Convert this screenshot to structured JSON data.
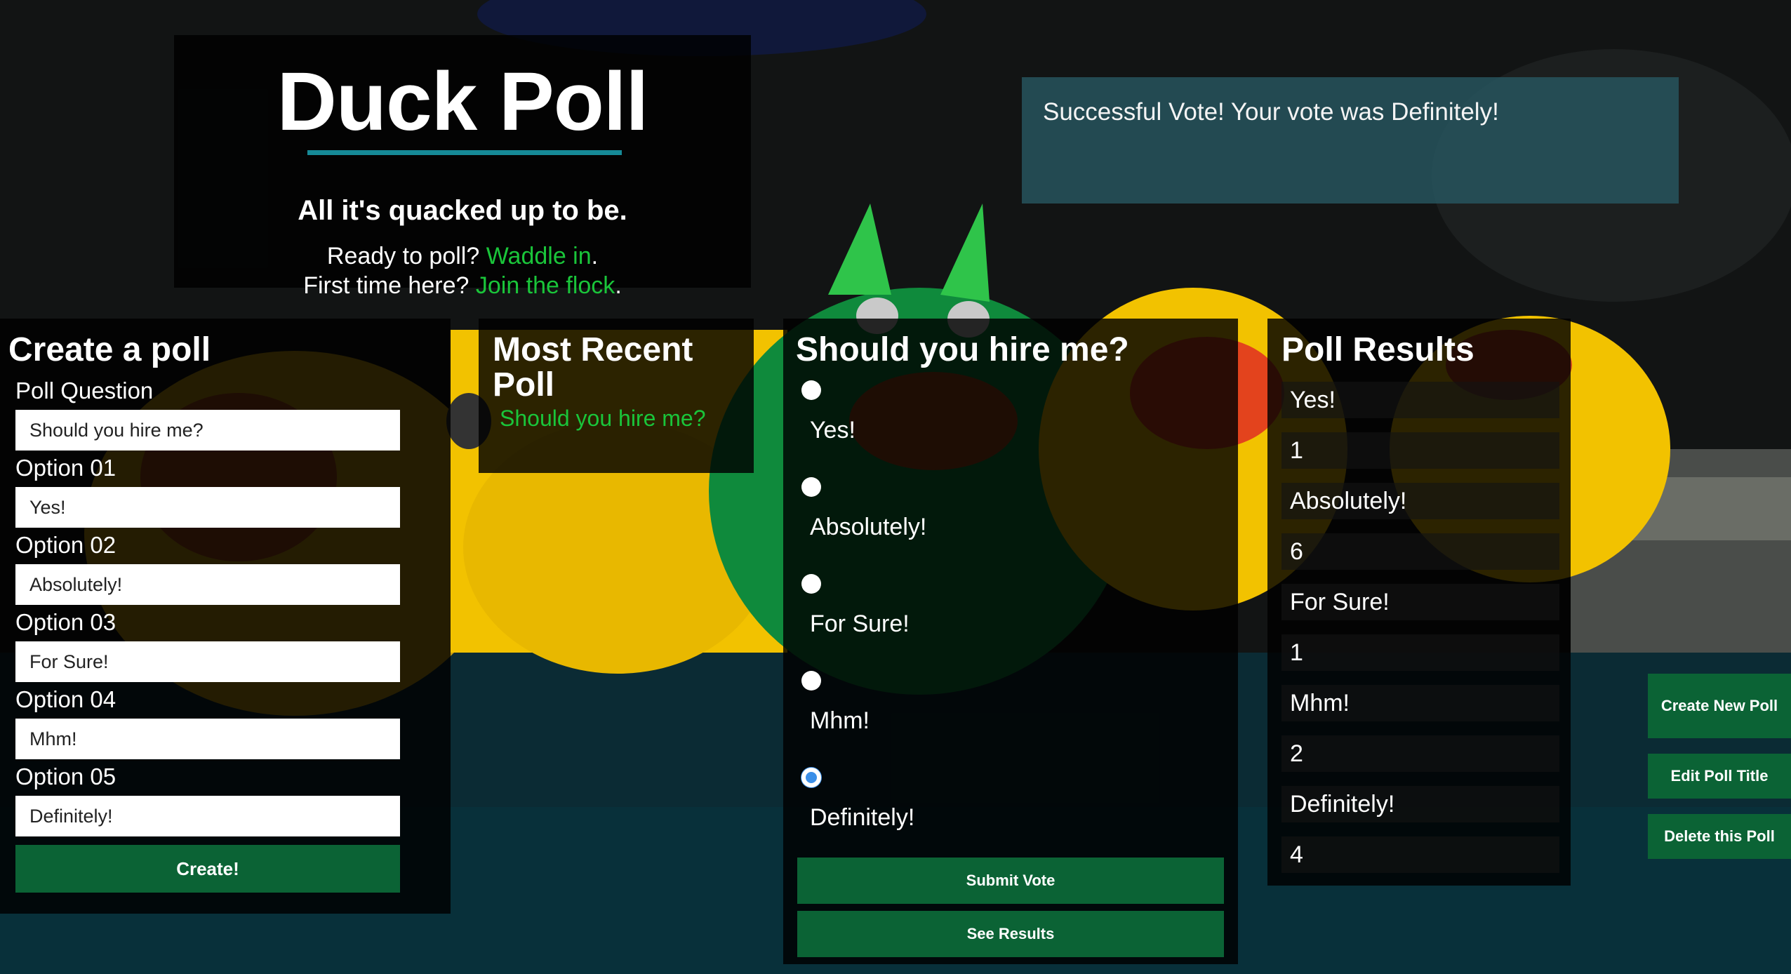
{
  "header": {
    "title": "Duck Poll",
    "tagline": "All it's quacked up to be.",
    "ready_text": "Ready to poll?",
    "ready_link": "Waddle in",
    "ready_period": ".",
    "first_text": "First time here?",
    "first_link": "Join the flock",
    "first_period": "."
  },
  "flash": {
    "message": "Successful Vote! Your vote was Definitely!"
  },
  "create_poll": {
    "title": "Create a poll",
    "question_label": "Poll Question",
    "question_value": "Should you hire me?",
    "options": [
      {
        "label": "Option 01",
        "value": "Yes!"
      },
      {
        "label": "Option 02",
        "value": "Absolutely!"
      },
      {
        "label": "Option 03",
        "value": "For Sure!"
      },
      {
        "label": "Option 04",
        "value": "Mhm!"
      },
      {
        "label": "Option 05",
        "value": "Definitely!"
      }
    ],
    "submit_label": "Create!"
  },
  "recent_poll": {
    "title": "Most Recent Poll",
    "link": "Should you hire me?"
  },
  "vote": {
    "question": "Should you hire me?",
    "choices": [
      {
        "label": "Yes!",
        "checked": false
      },
      {
        "label": "Absolutely!",
        "checked": false
      },
      {
        "label": "For Sure!",
        "checked": false
      },
      {
        "label": "Mhm!",
        "checked": false
      },
      {
        "label": "Definitely!",
        "checked": true
      }
    ],
    "submit_label": "Submit Vote",
    "results_label": "See Results"
  },
  "results": {
    "title": "Poll Results",
    "rows": [
      {
        "option": "Yes!",
        "count": "1"
      },
      {
        "option": "Absolutely!",
        "count": "6"
      },
      {
        "option": "For Sure!",
        "count": "1"
      },
      {
        "option": "Mhm!",
        "count": "2"
      },
      {
        "option": "Definitely!",
        "count": "4"
      }
    ]
  },
  "actions": {
    "create_new": "Create New Poll",
    "edit_title": "Edit Poll Title",
    "delete_poll": "Delete this Poll"
  },
  "colors": {
    "accent_green": "#1ac53a",
    "button_green": "#0b6335",
    "rule_teal": "#168a97",
    "radio_selected": "#3b8fe8"
  }
}
